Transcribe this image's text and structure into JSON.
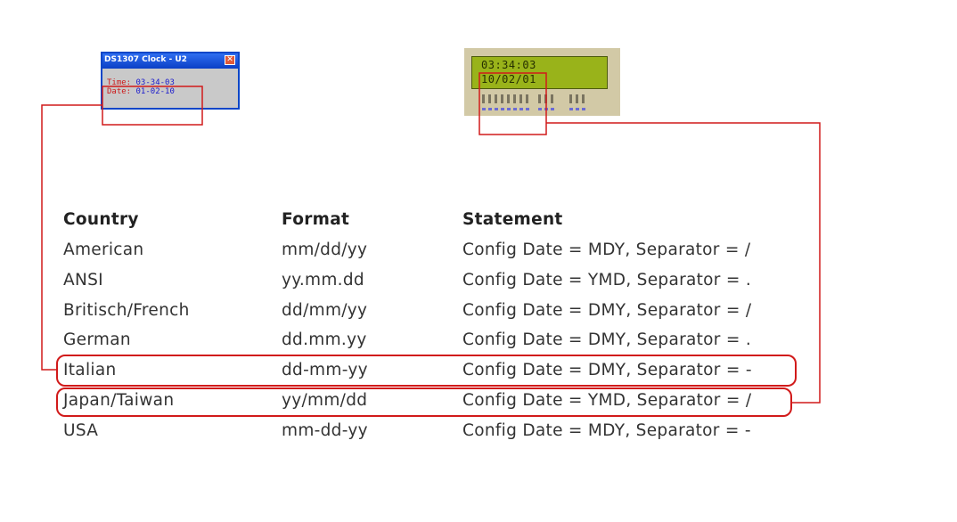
{
  "ds1307_window": {
    "title": "DS1307 Clock - U2",
    "close_glyph": "✕",
    "time_label": "Time:",
    "time_value": "03-34-03",
    "date_label": "Date:",
    "date_value": "01-02-10"
  },
  "lcd": {
    "line1": "03:34:03",
    "line2": "10/02/01"
  },
  "table": {
    "headers": {
      "country": "Country",
      "format": "Format",
      "statement": "Statement"
    },
    "rows": [
      {
        "country": "American",
        "format": "mm/dd/yy",
        "statement": "Config Date = MDY, Separator = /"
      },
      {
        "country": "ANSI",
        "format": "yy.mm.dd",
        "statement": "Config Date = YMD, Separator = ."
      },
      {
        "country": "Britisch/French",
        "format": "dd/mm/yy",
        "statement": "Config Date = DMY, Separator = /"
      },
      {
        "country": "German",
        "format": "dd.mm.yy",
        "statement": "Config Date = DMY, Separator = ."
      },
      {
        "country": "Italian",
        "format": "dd-mm-yy",
        "statement": "Config Date = DMY, Separator = -",
        "highlighted": true
      },
      {
        "country": "Japan/Taiwan",
        "format": "yy/mm/dd",
        "statement": "Config Date = YMD, Separator = /",
        "highlighted": true
      },
      {
        "country": "USA",
        "format": "mm-dd-yy",
        "statement": "Config Date = MDY, Separator = -"
      }
    ]
  },
  "colors": {
    "annotation": "#d11a1a",
    "window_border": "#0a46c8",
    "lcd_screen": "#99b31a"
  }
}
